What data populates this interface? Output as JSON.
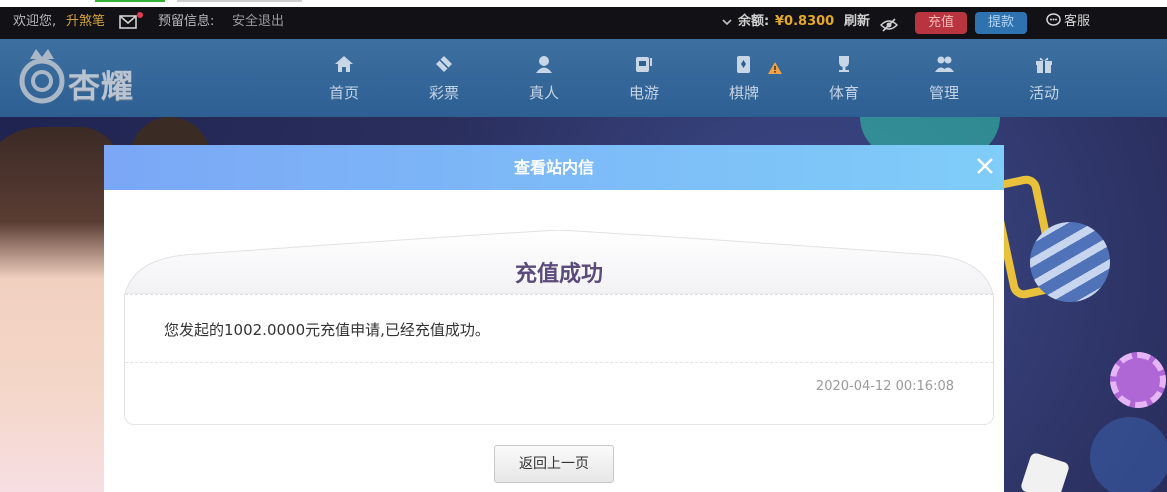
{
  "topbar": {
    "welcome": "欢迎您,",
    "username": "升煞笔",
    "notice": "预留信息:",
    "logout": "安全退出",
    "balance_label": "余额:",
    "balance_value": "¥0.8300",
    "refresh": "刷新",
    "recharge": "充值",
    "withdraw": "提款",
    "service": "客服"
  },
  "logo": {
    "text": "杏耀"
  },
  "nav": {
    "items": [
      {
        "label": "首页",
        "icon": "home-icon"
      },
      {
        "label": "彩票",
        "icon": "diamond-icon"
      },
      {
        "label": "真人",
        "icon": "dealer-icon"
      },
      {
        "label": "电游",
        "icon": "slot-icon"
      },
      {
        "label": "棋牌",
        "icon": "cards-icon"
      },
      {
        "label": "体育",
        "icon": "trophy-icon"
      },
      {
        "label": "管理",
        "icon": "users-icon"
      },
      {
        "label": "活动",
        "icon": "gift-icon"
      }
    ]
  },
  "modal": {
    "title": "查看站内信",
    "letter_title": "充值成功",
    "letter_body": "您发起的1002.0000元充值申请,已经充值成功。",
    "letter_time": "2020-04-12 00:16:08",
    "back_button": "返回上一页"
  },
  "colors": {
    "accent_gold": "#e3a82c",
    "recharge_btn": "#b8343e",
    "withdraw_btn": "#2f72b0",
    "modal_header_start": "#7ba7f6",
    "modal_header_end": "#7fcdf9",
    "nav_bg": "#2d5f93"
  }
}
